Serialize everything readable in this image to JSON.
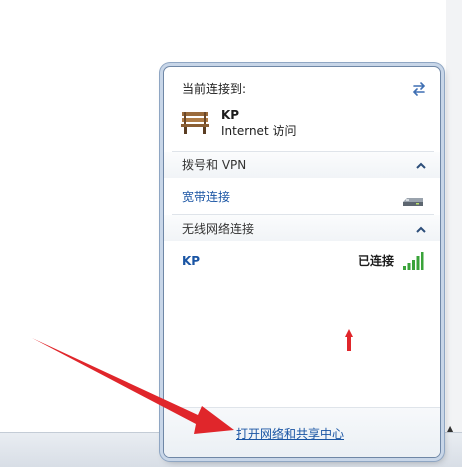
{
  "popup": {
    "current_heading": "当前连接到:",
    "refresh_icon": "refresh-arrows-icon",
    "current_network": {
      "icon": "bench-icon",
      "name": "KP",
      "access": "Internet 访问"
    },
    "dialup_section": {
      "title": "拨号和 VPN",
      "expanded": true,
      "items": [
        {
          "label": "宽带连接",
          "icon": "modem-icon"
        }
      ]
    },
    "wireless_section": {
      "title": "无线网络连接",
      "expanded": true,
      "items": [
        {
          "name": "KP",
          "status": "已连接",
          "icon": "signal-bars-icon"
        }
      ]
    },
    "footer_link": "打开网络和共享中心"
  },
  "colors": {
    "link": "#1a55a4",
    "annotation_arrow": "#e0262b",
    "signal": "#3aa33a"
  }
}
